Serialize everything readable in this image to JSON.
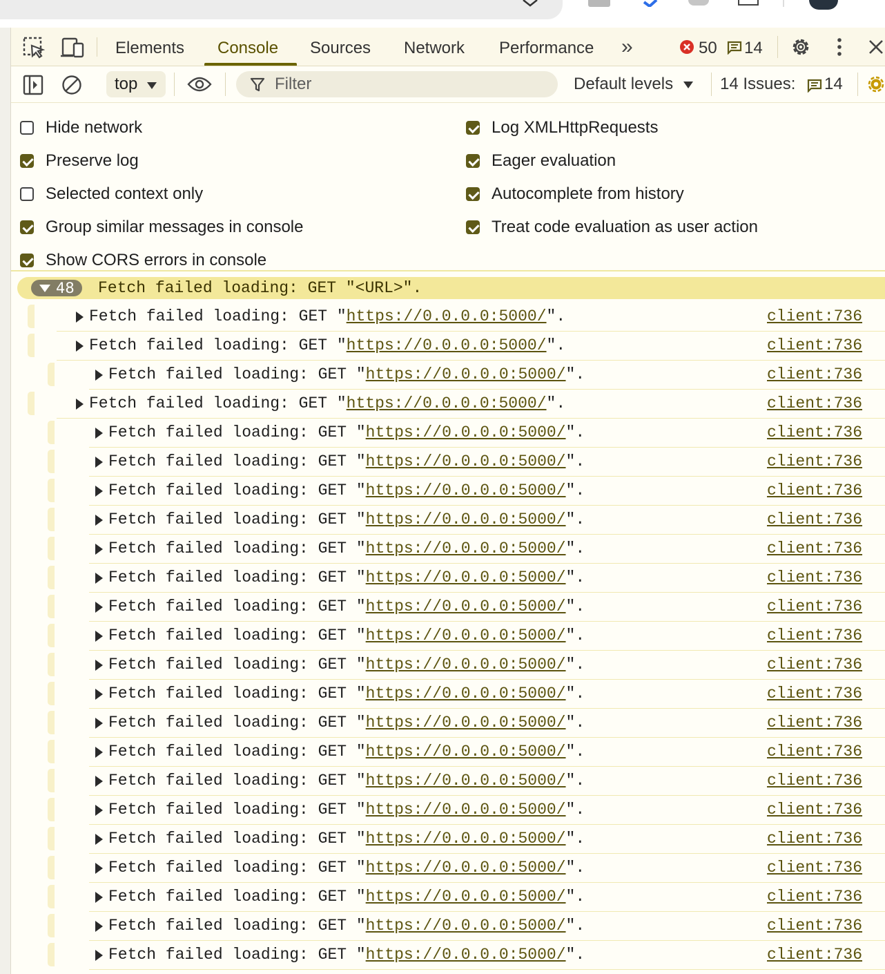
{
  "tabs": {
    "elements": "Elements",
    "console": "Console",
    "sources": "Sources",
    "network": "Network",
    "performance": "Performance",
    "more": "»",
    "error_count": "50",
    "message_count": "14"
  },
  "toolbar": {
    "context": "top",
    "filter_placeholder": "Filter",
    "levels": "Default levels",
    "issues_label": "14 Issues:",
    "issues_count": "14"
  },
  "settings": {
    "left": [
      {
        "label": "Hide network",
        "checked": false
      },
      {
        "label": "Preserve log",
        "checked": true
      },
      {
        "label": "Selected context only",
        "checked": false
      },
      {
        "label": "Group similar messages in console",
        "checked": true
      },
      {
        "label": "Show CORS errors in console",
        "checked": true
      }
    ],
    "right": [
      {
        "label": "Log XMLHttpRequests",
        "checked": true
      },
      {
        "label": "Eager evaluation",
        "checked": true
      },
      {
        "label": "Autocomplete from history",
        "checked": true
      },
      {
        "label": "Treat code evaluation as user action",
        "checked": true
      }
    ]
  },
  "group": {
    "count": "48",
    "message": "Fetch failed loading: GET \"<URL>\"."
  },
  "log": {
    "prefix": "Fetch failed loading: GET \"",
    "url": "https://0.0.0.0:5000/",
    "suffix": "\".",
    "source": "client:736",
    "rows": [
      {
        "indent": 1
      },
      {
        "indent": 1
      },
      {
        "indent": 2
      },
      {
        "indent": 1
      },
      {
        "indent": 2
      },
      {
        "indent": 2
      },
      {
        "indent": 2
      },
      {
        "indent": 2
      },
      {
        "indent": 2
      },
      {
        "indent": 2
      },
      {
        "indent": 2
      },
      {
        "indent": 2
      },
      {
        "indent": 2
      },
      {
        "indent": 2
      },
      {
        "indent": 2
      },
      {
        "indent": 2
      },
      {
        "indent": 2
      },
      {
        "indent": 2
      },
      {
        "indent": 2
      },
      {
        "indent": 2
      },
      {
        "indent": 2
      },
      {
        "indent": 2
      },
      {
        "indent": 2
      }
    ]
  },
  "colors": {
    "accent": "#6b6400",
    "group_bg": "#f3e89a",
    "error": "#d93025"
  }
}
